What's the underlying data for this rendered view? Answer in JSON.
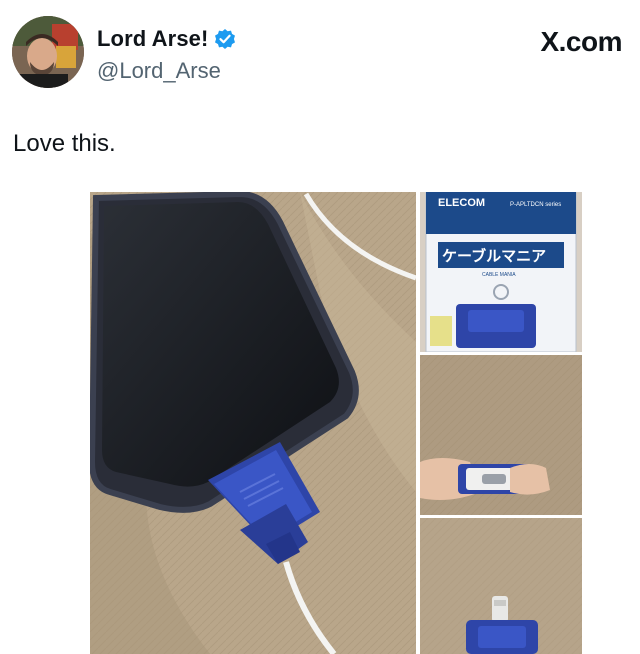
{
  "author": {
    "display_name": "Lord Arse!",
    "handle": "@Lord_Arse",
    "verified": true,
    "avatar_icon": "profile-avatar"
  },
  "brand": "X.com",
  "tweet": {
    "text": "Love this."
  },
  "media": {
    "package_brand": "ELECOM",
    "package_series": "P-APLTDCN series",
    "package_title": "ケーブルマニア",
    "package_subtitle": "CABLE MANIA"
  },
  "colors": {
    "verified_blue": "#1d9bf0",
    "handle_gray": "#536471",
    "text": "#0f1419",
    "adapter_blue": "#2e45a8"
  }
}
